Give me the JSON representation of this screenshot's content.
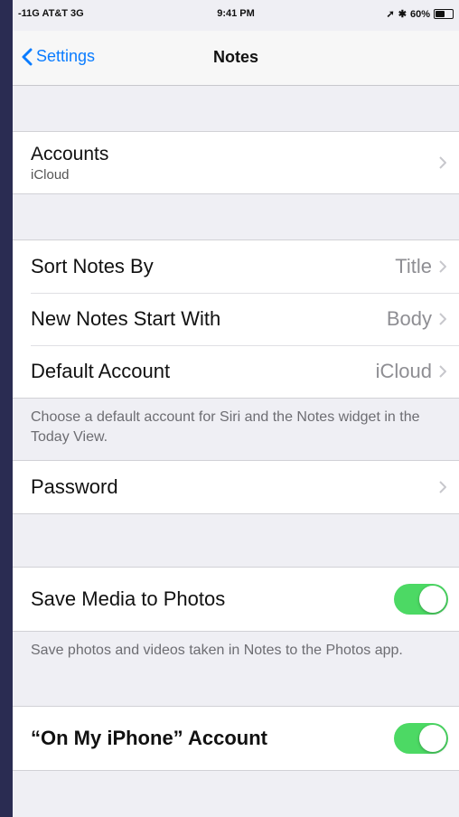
{
  "status_bar": {
    "carrier": "-11G AT&T 3G",
    "time": "9:41 PM",
    "battery": "60%",
    "battery_level": 0.6
  },
  "nav": {
    "back_label": "Settings",
    "title": "Notes"
  },
  "accounts": {
    "label": "Accounts",
    "sub": "iCloud"
  },
  "sort": {
    "label": "Sort Notes By",
    "value": "Title"
  },
  "new_notes": {
    "label": "New Notes Start With",
    "value": "Body"
  },
  "default_account": {
    "label": "Default Account",
    "value": "iCloud"
  },
  "default_footer": "Choose a default account for Siri and the Notes widget in the Today View.",
  "password": {
    "label": "Password"
  },
  "save_media": {
    "label": "Save Media to Photos",
    "on": true
  },
  "save_media_footer": "Save photos and videos taken in Notes to the Photos app.",
  "on_my_iphone": {
    "label": "“On My iPhone” Account",
    "on": true
  },
  "colors": {
    "accent": "#0a7cff",
    "toggle_on": "#4cd964"
  }
}
